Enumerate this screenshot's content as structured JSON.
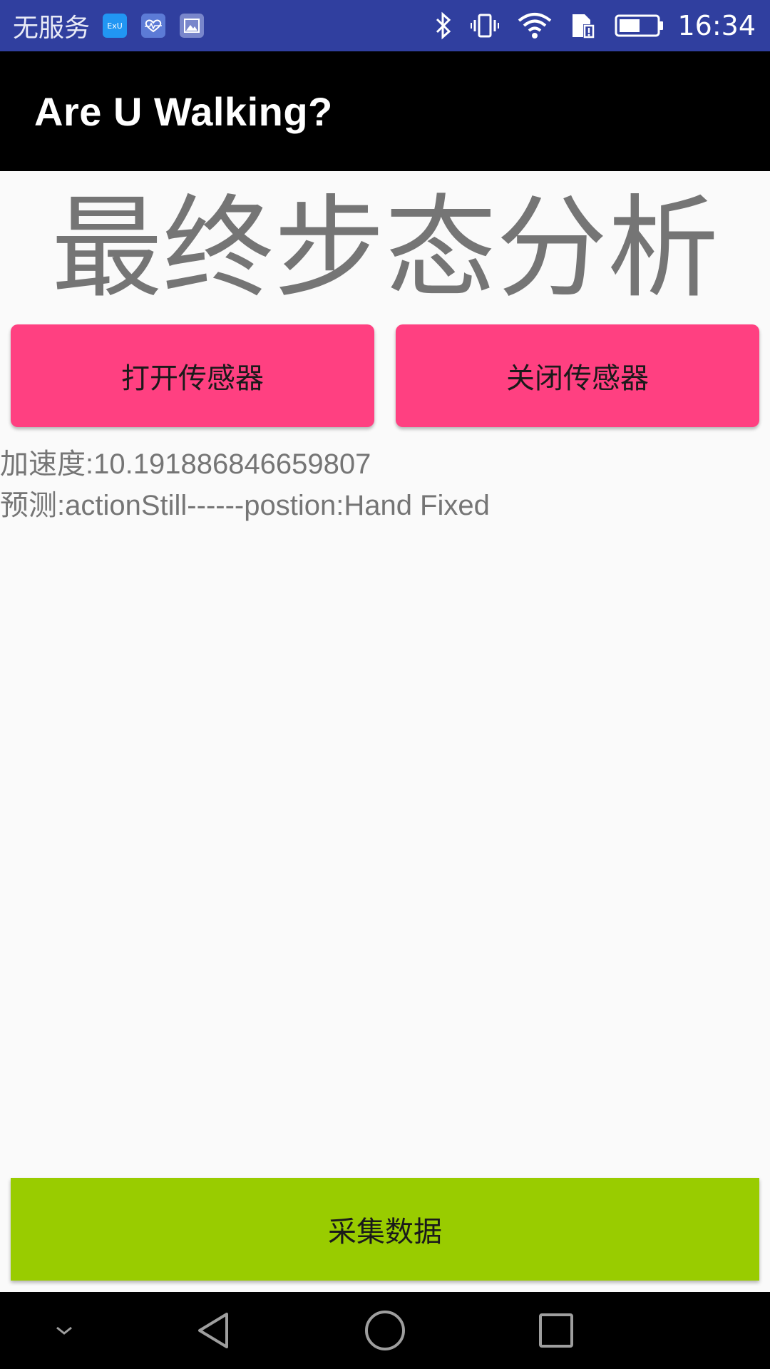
{
  "status_bar": {
    "carrier": "无服务",
    "app_icon_1": "ExU",
    "time": "16:34",
    "icons": [
      "bluetooth-icon",
      "vibrate-icon",
      "wifi-icon",
      "sim-icon",
      "battery-icon"
    ]
  },
  "app_bar": {
    "title": "Are U Walking?"
  },
  "main": {
    "heading": "最终步态分析",
    "open_sensor_label": "打开传感器",
    "close_sensor_label": "关闭传感器",
    "acceleration_text": "加速度:10.191886846659807",
    "prediction_text": "预测:actionStill------postion:Hand Fixed",
    "collect_data_label": "采集数据"
  },
  "nav_bar": {
    "icons": [
      "chevron-down-icon",
      "back-icon",
      "home-icon",
      "recents-icon"
    ]
  },
  "colors": {
    "status_bar": "#303f9f",
    "app_bar": "#000000",
    "accent_pink": "#ff4081",
    "accent_green": "#99cc00",
    "text_gray": "#757575"
  }
}
